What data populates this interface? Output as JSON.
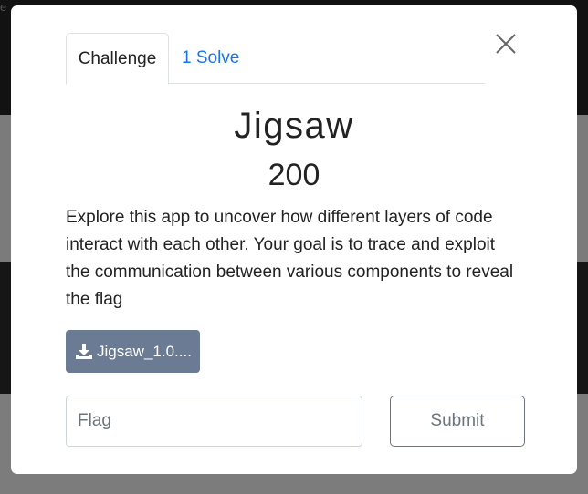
{
  "background": {
    "top_fragment": "e"
  },
  "modal": {
    "tabs": [
      {
        "label": "Challenge",
        "active": true
      },
      {
        "label": "1 Solve",
        "active": false
      }
    ],
    "close_icon": "close-icon",
    "title": "Jigsaw",
    "value": "200",
    "description": "Explore this app to uncover how different layers of code interact with each other. Your goal is to trace and exploit the communication between various components to reveal the flag",
    "download": {
      "label": "Jigsaw_1.0....",
      "icon": "download-icon"
    },
    "flag_input": {
      "placeholder": "Flag",
      "value": ""
    },
    "submit_label": "Submit"
  },
  "colors": {
    "accent_link": "#1a73e8",
    "download_button": "#6b7b94",
    "overlay": "#7b7b7b"
  }
}
